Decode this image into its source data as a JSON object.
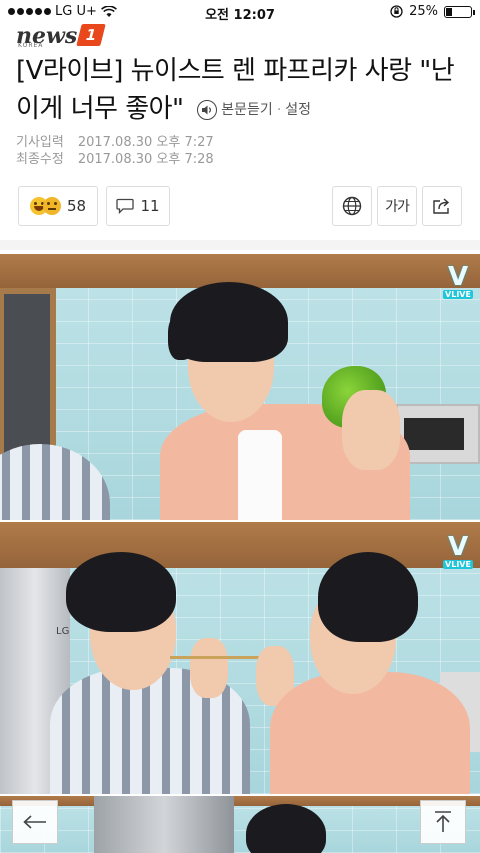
{
  "status_bar": {
    "carrier": "LG U+",
    "time": "오전 12:07",
    "battery_percent_label": "25%",
    "battery_level": 0.25,
    "signal_dots_filled": 5,
    "icons": [
      "wifi-icon",
      "rotation-lock-icon",
      "battery-icon"
    ]
  },
  "logo": {
    "word": "news",
    "mark": "1",
    "sub": "KOREA"
  },
  "article": {
    "headline": "[V라이브] 뉴이스트 렌 파프리카 사랑 \"난 이게 너무 좋아\"",
    "read_aloud_label": "본문듣기",
    "separator": "·",
    "settings_label": "설정",
    "posted_label": "기사입력",
    "posted_time": "2017.08.30 오후 7:27",
    "updated_label": "최종수정",
    "updated_time": "2017.08.30 오후 7:28"
  },
  "toolbar": {
    "reaction_count": "58",
    "comment_count": "11",
    "font_size_label": "가가",
    "icons": [
      "reaction-emoji-icon",
      "comment-icon",
      "globe-icon",
      "font-size-icon",
      "share-icon"
    ]
  },
  "photos": {
    "watermark_text": "VLIVE"
  },
  "nav": {
    "icons": [
      "back-arrow-icon",
      "scroll-top-icon"
    ]
  }
}
